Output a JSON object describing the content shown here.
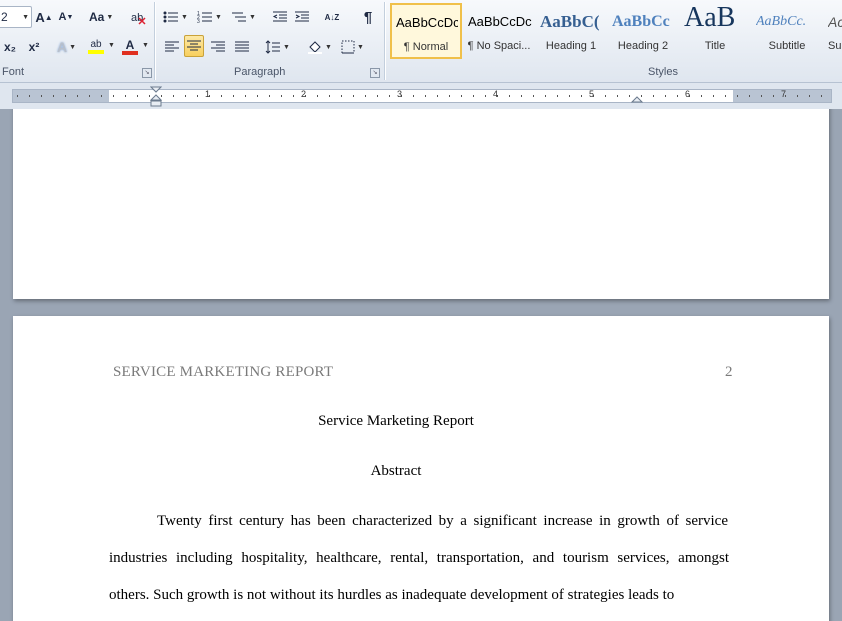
{
  "ribbon": {
    "font": {
      "size_value": "2",
      "grow_label": "A",
      "shrink_label": "A",
      "change_case_label": "Aa",
      "subscript_label": "x₂",
      "superscript_label": "x²",
      "clear_format_label": "A",
      "highlight_label": "ab",
      "font_color_label": "A",
      "group_label": "Font",
      "highlight_color": "#ffff00",
      "font_color": "#e03020"
    },
    "paragraph": {
      "group_label": "Paragraph",
      "show_marks_label": "¶",
      "sort_label": "A↓Z"
    },
    "styles": {
      "group_label": "Styles",
      "items": [
        {
          "sample": "AaBbCcDc",
          "name": "¶ Normal",
          "selected": true
        },
        {
          "sample": "AaBbCcDc",
          "name": "¶ No Spaci...",
          "selected": false
        },
        {
          "sample": "AaBbC(",
          "name": "Heading 1",
          "selected": false
        },
        {
          "sample": "AaBbCc",
          "name": "Heading 2",
          "selected": false
        },
        {
          "sample": "AaB",
          "name": "Title",
          "selected": false
        },
        {
          "sample": "AaBbCc.",
          "name": "Subtitle",
          "selected": false
        },
        {
          "sample": "Ac",
          "name": "Su",
          "selected": false
        }
      ]
    }
  },
  "ruler": {
    "numbers": [
      "1",
      "2",
      "3",
      "4",
      "5",
      "6",
      "7"
    ]
  },
  "document": {
    "header_left": "SERVICE MARKETING REPORT",
    "header_right": "2",
    "title": "Service Marketing Report",
    "abstract_heading": "Abstract",
    "lines": [
      "Twenty first century has been characterized by a significant increase in growth of service",
      "industries including hospitality, healthcare, rental, transportation, and tourism services, amongst",
      "others. Such growth is not without its hurdles as inadequate development of strategies leads to"
    ]
  }
}
